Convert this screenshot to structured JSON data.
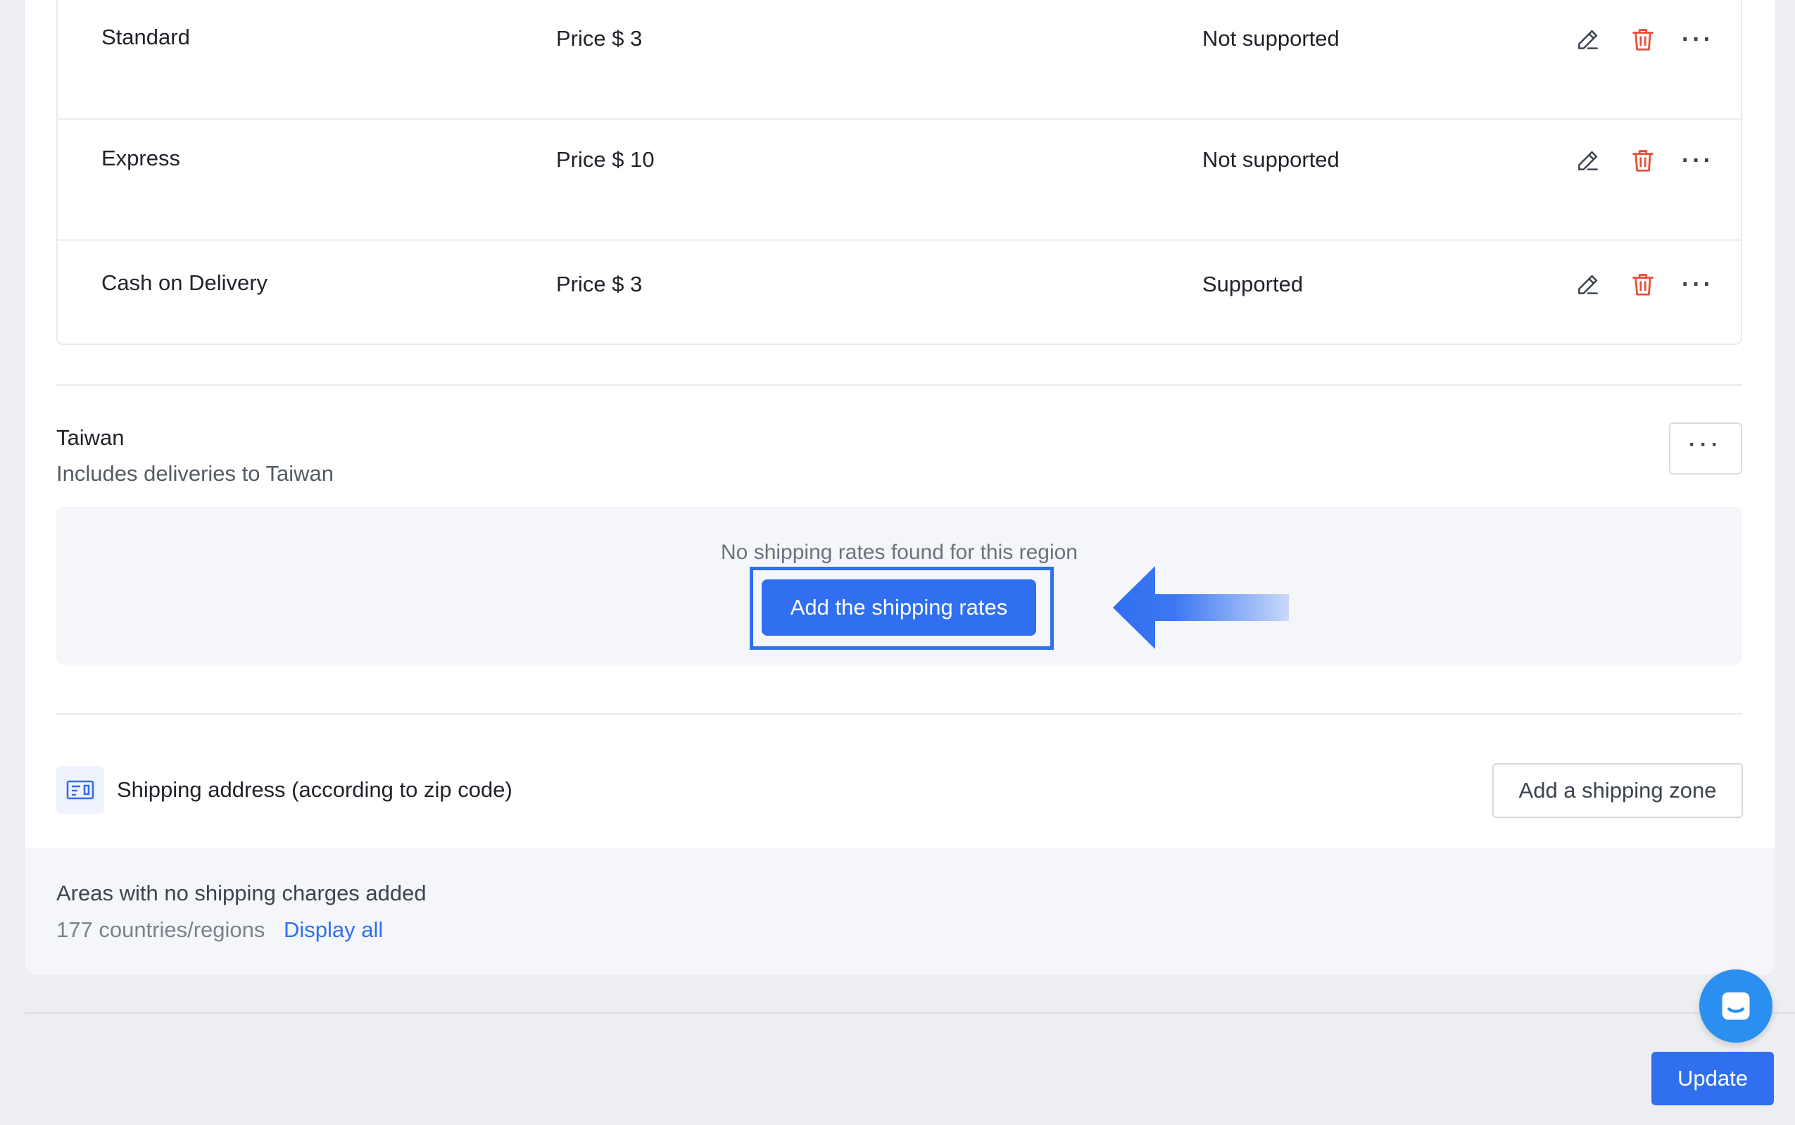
{
  "rates": [
    {
      "name": "Standard",
      "price": "Price $ 3",
      "cod": "Not supported"
    },
    {
      "name": "Express",
      "price": "Price $ 10",
      "cod": "Not supported"
    },
    {
      "name": "Cash on Delivery",
      "price": "Price $ 3",
      "cod": "Supported"
    }
  ],
  "icons": {
    "edit": "edit-pencil-icon",
    "delete": "trash-icon",
    "more": "more-horizontal-icon"
  },
  "zone": {
    "title": "Taiwan",
    "subtitle": "Includes deliveries to Taiwan",
    "empty_text": "No shipping rates found for this region",
    "add_rates_label": "Add the shipping rates"
  },
  "shipping_address": {
    "label": "Shipping address (according to zip code)",
    "add_zone_label": "Add a shipping zone"
  },
  "no_charge_areas": {
    "title": "Areas with no shipping charges added",
    "count": "177 countries/regions",
    "display_all": "Display all"
  },
  "footer": {
    "update_label": "Update"
  },
  "colors": {
    "accent": "#2f6ff0",
    "delete": "#e8503a",
    "chat": "#2a8ff0"
  }
}
